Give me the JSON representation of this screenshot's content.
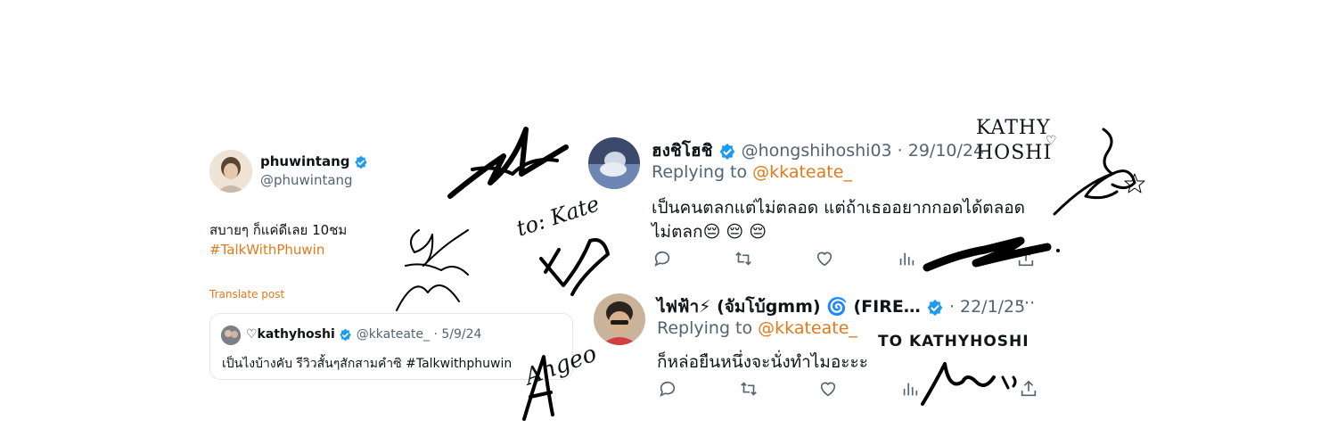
{
  "post": {
    "display_name": "phuwintang",
    "handle": "@phuwintang",
    "text_line1": "สบายๆ ก็แค่ดีเลย 10ชม",
    "hashtag": "#TalkWithPhuwin",
    "translate": "Translate post"
  },
  "quote": {
    "display_name": "♡kathyhoshi",
    "handle": "@kkateate_",
    "date": "· 5/9/24",
    "text": "เป็นไงบ้างคับ รีวิวสั้นๆสักสามคำซิ #Talkwithphuwin"
  },
  "reply1": {
    "display_name": "ฮงชิโฮชิ",
    "handle": "@hongshihoshi03",
    "date": "· 29/10/24",
    "replying_label": "Replying to",
    "replying_handle": "@kkateate_",
    "text_line1": "เป็นคนตลกแต่ไม่ตลอด แต่ถ้าเธออยากกอดได้ตลอด",
    "text_line2": "ไม่ตลก",
    "emoji": "😔 😔 😔"
  },
  "reply2": {
    "display_name": "ไฟฟ้า⚡ (จัมโบ้gmm) 🌀 (FIRE…",
    "date": "· 22/1/25",
    "more": "···",
    "replying_label": "Replying to",
    "replying_handle": "@kkateate_",
    "text": "ก็หล่อยืนหนึ่งจะนั่งทำไมอะะะ"
  },
  "signature_texts": {
    "to_kate": "to: Kate",
    "kathy_hoshi": "KATHY HOSHI",
    "to_kathyhoshi": "TO KATHYHOSHI",
    "ahgeo": "Ahgeo"
  },
  "colors": {
    "link": "#e07a1a",
    "verified": "#1d9bf0",
    "muted": "#536471"
  }
}
